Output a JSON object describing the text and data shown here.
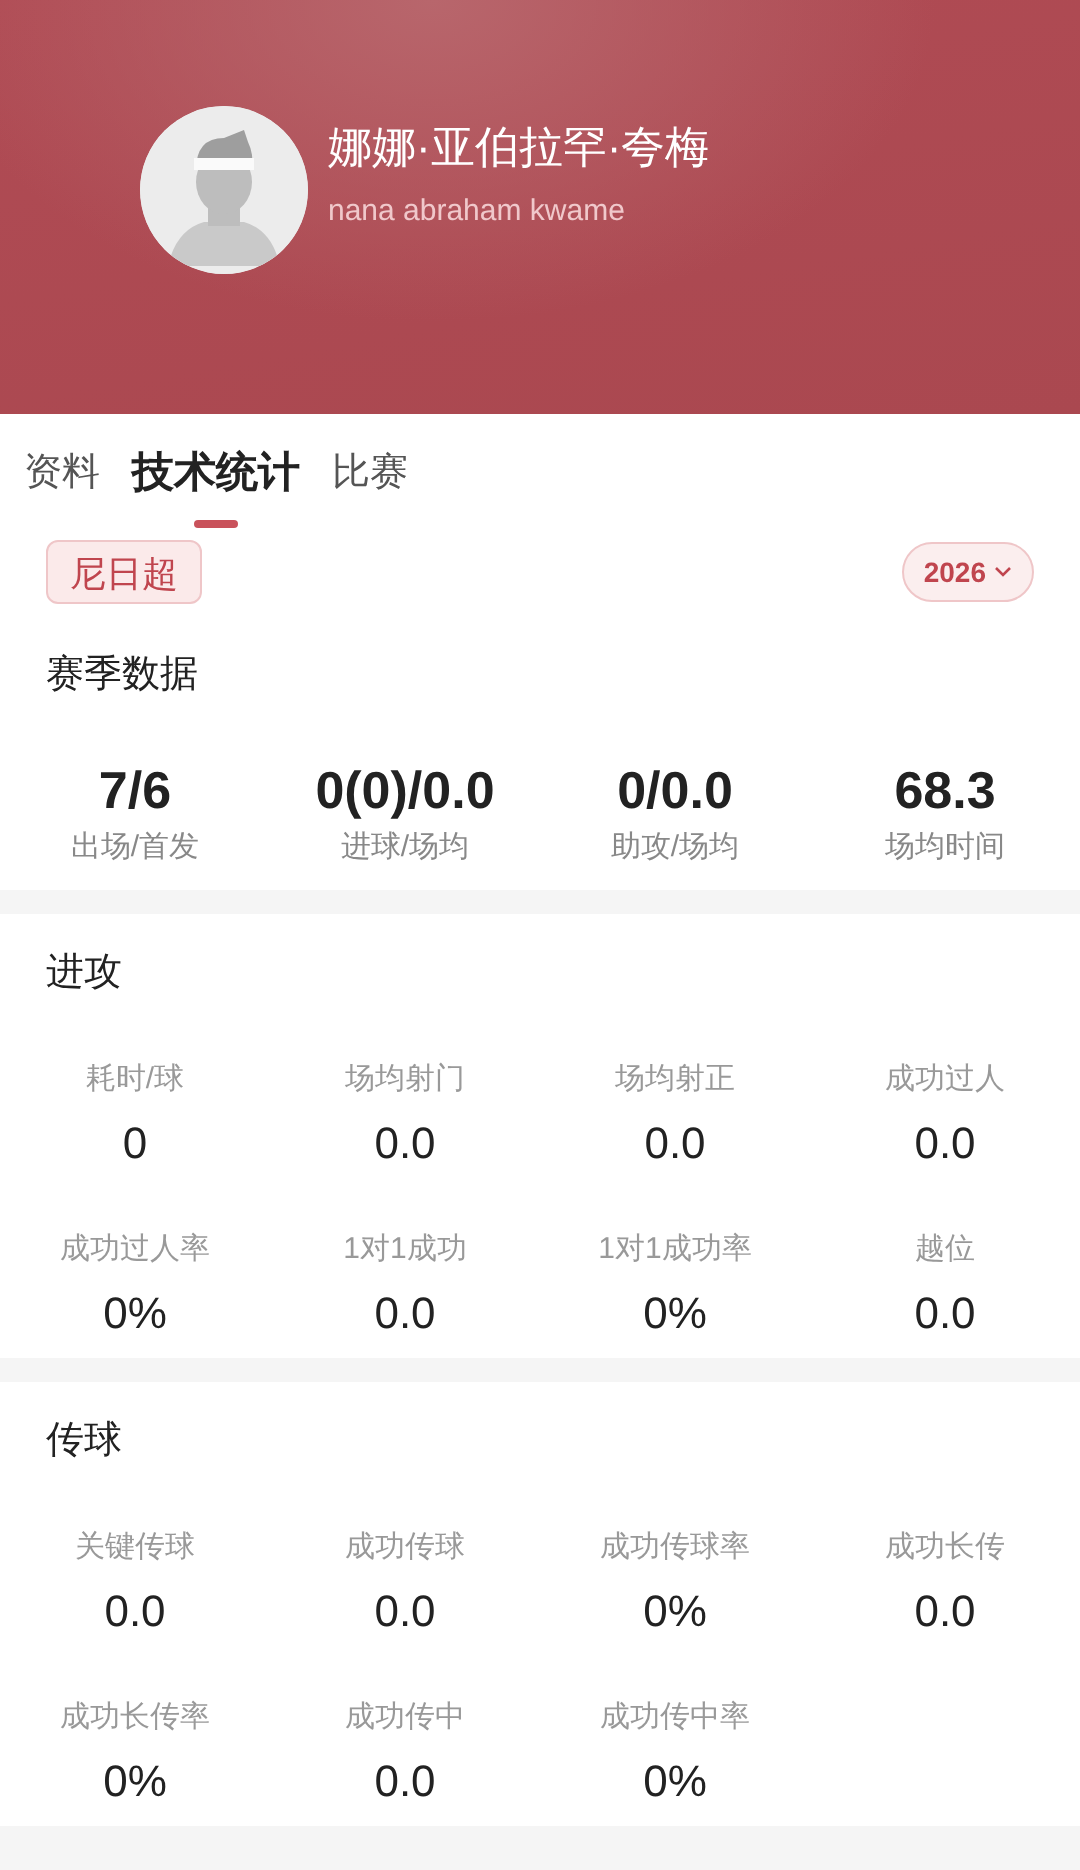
{
  "header": {
    "name": "娜娜·亚伯拉罕·夸梅",
    "name_en": "nana abraham kwame"
  },
  "tabs": [
    {
      "label": "资料",
      "selected": false
    },
    {
      "label": "技术统计",
      "selected": true
    },
    {
      "label": "比赛",
      "selected": false
    }
  ],
  "league": "尼日超",
  "season": "2026",
  "summary": {
    "title": "赛季数据",
    "stats": [
      {
        "value": "7/6",
        "label": "出场/首发"
      },
      {
        "value": "0(0)/0.0",
        "label": "进球/场均"
      },
      {
        "value": "0/0.0",
        "label": "助攻/场均"
      },
      {
        "value": "68.3",
        "label": "场均时间"
      }
    ]
  },
  "sections": [
    {
      "title": "进攻",
      "stats": [
        {
          "label": "耗时/球",
          "value": "0"
        },
        {
          "label": "场均射门",
          "value": "0.0"
        },
        {
          "label": "场均射正",
          "value": "0.0"
        },
        {
          "label": "成功过人",
          "value": "0.0"
        },
        {
          "label": "成功过人率",
          "value": "0%"
        },
        {
          "label": "1对1成功",
          "value": "0.0"
        },
        {
          "label": "1对1成功率",
          "value": "0%"
        },
        {
          "label": "越位",
          "value": "0.0"
        }
      ]
    },
    {
      "title": "传球",
      "stats": [
        {
          "label": "关键传球",
          "value": "0.0"
        },
        {
          "label": "成功传球",
          "value": "0.0"
        },
        {
          "label": "成功传球率",
          "value": "0%"
        },
        {
          "label": "成功长传",
          "value": "0.0"
        },
        {
          "label": "成功长传率",
          "value": "0%"
        },
        {
          "label": "成功传中",
          "value": "0.0"
        },
        {
          "label": "成功传中率",
          "value": "0%"
        }
      ]
    }
  ]
}
